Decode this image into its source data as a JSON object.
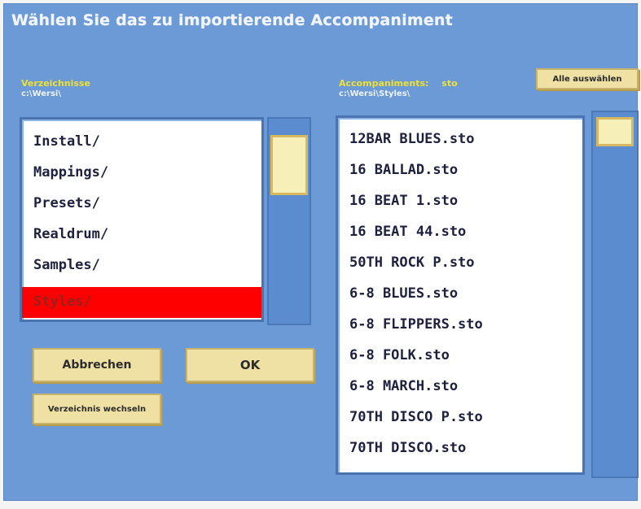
{
  "title": "Wählen Sie das zu importierende Accompaniment",
  "left_panel": {
    "header": "Verzeichnisse",
    "path": "c:\\Wersi\\",
    "items": [
      "Install/",
      "Mappings/",
      "Presets/",
      "Realdrum/",
      "Samples/",
      "Styles/"
    ],
    "selected_index": 5
  },
  "right_panel": {
    "header": "Accompaniments:",
    "filter": "sto",
    "path": "c:\\Wersi\\Styles\\",
    "select_all_label": "Alle auswählen",
    "items": [
      "12BAR BLUES.sto",
      "16 BALLAD.sto",
      "16 BEAT 1.sto",
      "16 BEAT 44.sto",
      "50TH ROCK P.sto",
      "6-8 BLUES.sto",
      "6-8 FLIPPERS.sto",
      "6-8 FOLK.sto",
      "6-8 MARCH.sto",
      "70TH DISCO P.sto",
      "70TH DISCO.sto"
    ]
  },
  "buttons": {
    "cancel": "Abbrechen",
    "ok": "OK",
    "change_dir": "Verzeichnis wechseln"
  },
  "colors": {
    "background": "#6b9ad6",
    "selection": "#ff0000",
    "button": "#efe1a4",
    "header_yellow": "#f0e030"
  }
}
